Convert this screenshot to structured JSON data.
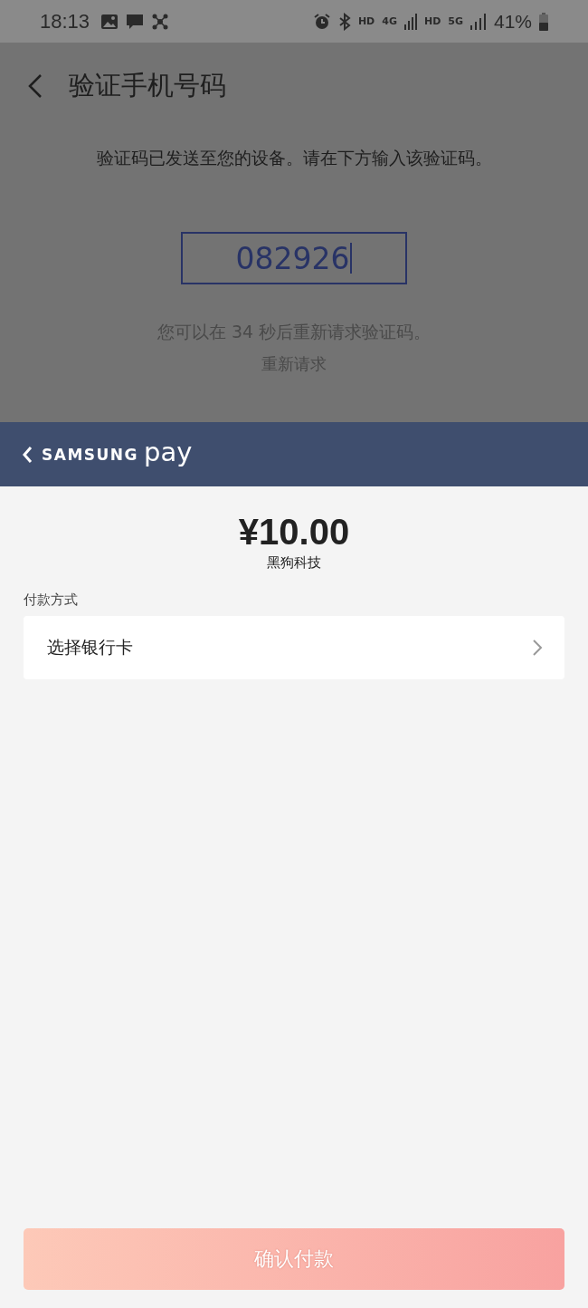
{
  "status_bar": {
    "time": "18:13",
    "network_1": "HD",
    "network_1_type": "4G",
    "network_2": "HD",
    "network_2_type": "5G",
    "battery": "41%"
  },
  "background_screen": {
    "title": "验证手机号码",
    "message": "验证码已发送至您的设备。请在下方输入该验证码。",
    "code": "082926",
    "countdown": "您可以在 34 秒后重新请求验证码。",
    "resend": "重新请求"
  },
  "sheet": {
    "logo_brand": "SAMSUNG",
    "logo_product": "pay",
    "amount": "¥10.00",
    "merchant": "黑狗科技",
    "payment_method_label": "付款方式",
    "payment_method": "选择银行卡",
    "confirm_button": {
      "label": "确认付款",
      "disabled": true
    }
  }
}
